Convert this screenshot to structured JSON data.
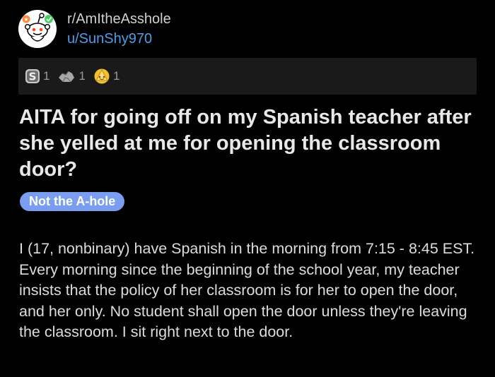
{
  "header": {
    "subreddit": "r/AmItheAsshole",
    "username": "u/SunShy970",
    "avatar_icon": "snoo-avatar-icon"
  },
  "awards": [
    {
      "icon": "silver-award-icon",
      "count": "1"
    },
    {
      "icon": "helpful-award-icon",
      "count": "1"
    },
    {
      "icon": "wholesome-award-icon",
      "count": "1"
    }
  ],
  "post": {
    "title": "AITA for going off on my Spanish teacher after she yelled at me for opening the classroom door?",
    "flair": "Not the A-hole",
    "body": "I (17, nonbinary) have Spanish in the morning from 7:15 - 8:45 EST. Every morning since the beginning of the school year, my teacher insists that the policy of her classroom is for her to open the door, and her only. No student shall open the door unless they're leaving the classroom. I sit right next to the door."
  },
  "colors": {
    "background": "#000000",
    "award_bar": "#1a1a1b",
    "username": "#4a9ee8",
    "flair": "#7a9df0"
  }
}
